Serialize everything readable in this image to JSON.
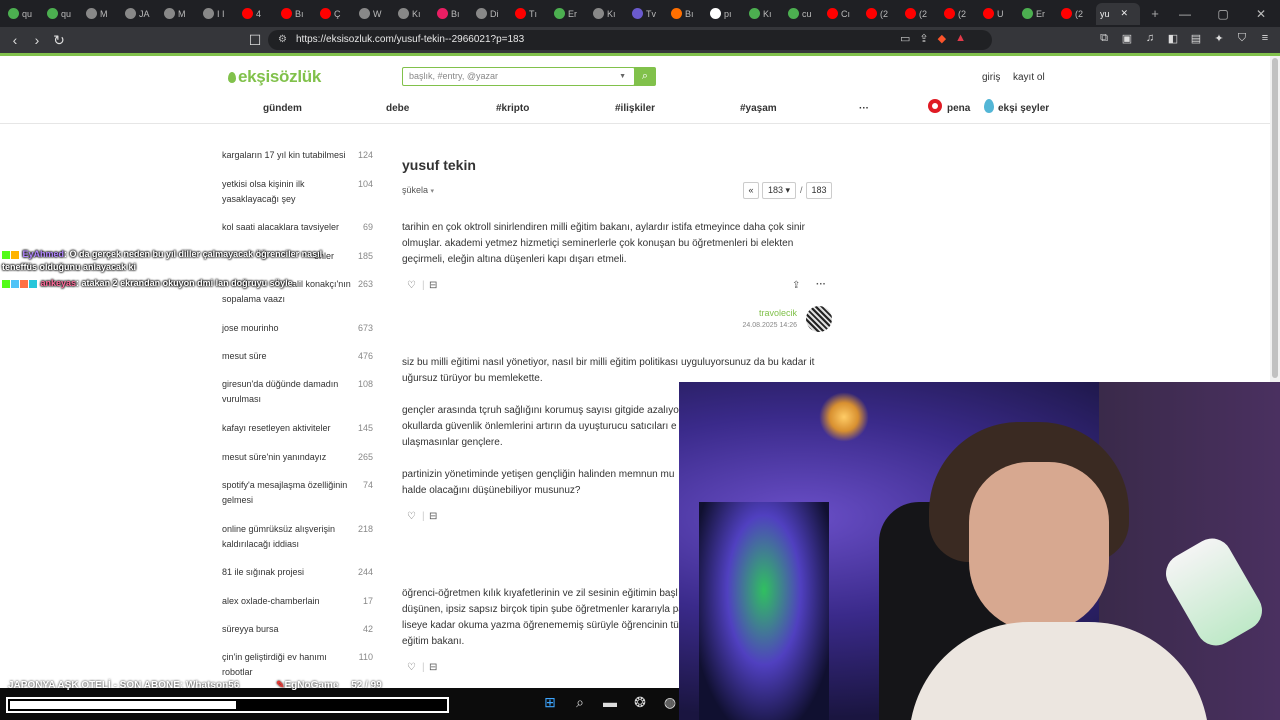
{
  "browser": {
    "tabs": [
      {
        "label": "qu",
        "color": "#4caf50"
      },
      {
        "label": "qu",
        "color": "#4caf50"
      },
      {
        "label": "M",
        "color": "#888"
      },
      {
        "label": "JA",
        "color": "#888"
      },
      {
        "label": "M",
        "color": "#888"
      },
      {
        "label": "I I",
        "color": "#888"
      },
      {
        "label": "4",
        "color": "#ff0000"
      },
      {
        "label": "Bı",
        "color": "#ff0000"
      },
      {
        "label": "Ç",
        "color": "#ff0000"
      },
      {
        "label": "W",
        "color": "#888"
      },
      {
        "label": "Kı",
        "color": "#888"
      },
      {
        "label": "Bı",
        "color": "#e91e63"
      },
      {
        "label": "Di",
        "color": "#888"
      },
      {
        "label": "Tı",
        "color": "#ff0000"
      },
      {
        "label": "Er",
        "color": "#4caf50"
      },
      {
        "label": "Kı",
        "color": "#888"
      },
      {
        "label": "Tv",
        "color": "#6a5acd"
      },
      {
        "label": "Bı",
        "color": "#ff6f00"
      },
      {
        "label": "pı",
        "color": "#fff"
      },
      {
        "label": "Kı",
        "color": "#4caf50"
      },
      {
        "label": "cu",
        "color": "#4caf50"
      },
      {
        "label": "Cı",
        "color": "#ff0000"
      },
      {
        "label": "(2",
        "color": "#ff0000"
      },
      {
        "label": "(2",
        "color": "#ff0000"
      },
      {
        "label": "(2",
        "color": "#ff0000"
      },
      {
        "label": "U",
        "color": "#ff0000"
      },
      {
        "label": "Er",
        "color": "#4caf50"
      },
      {
        "label": "(2",
        "color": "#ff0000"
      }
    ],
    "active_tab": {
      "label": "yu"
    },
    "url": "https://eksisozluk.com/yusuf-tekin--2966021?p=183"
  },
  "site": {
    "logo": "ekşisözlük",
    "search_placeholder": "başlık, #entry, @yazar",
    "login": "giriş",
    "register": "kayıt ol",
    "nav": [
      "gündem",
      "debe",
      "#kripto",
      "#ilişkiler",
      "#yaşam",
      "···"
    ],
    "pena": "pena",
    "seyler": "ekşi şeyler"
  },
  "sidebar": [
    {
      "title": "kargaların 17 yıl kin tutabilmesi",
      "count": "124"
    },
    {
      "title": "yetkisi olsa kişinin ilk yasaklayacağı şey",
      "count": "104"
    },
    {
      "title": "kol saati alacaklara tavsiyeler",
      "count": "69"
    },
    {
      "title": "enler",
      "count": "185"
    },
    {
      "title": "alil konakçı'nın sopalama vaazı",
      "count": "263"
    },
    {
      "title": "jose mourinho",
      "count": "673"
    },
    {
      "title": "mesut süre",
      "count": "476"
    },
    {
      "title": "giresun'da düğünde damadın vurulması",
      "count": "108"
    },
    {
      "title": "kafayı resetleyen aktiviteler",
      "count": "145"
    },
    {
      "title": "mesut süre'nin yanındayız",
      "count": "265"
    },
    {
      "title": "spotify'a mesajlaşma özelliğinin gelmesi",
      "count": "74"
    },
    {
      "title": "online gümrüksüz alışverişin kaldırılacağı iddiası",
      "count": "218"
    },
    {
      "title": "81 ile sığınak projesi",
      "count": "244"
    },
    {
      "title": "alex oxlade-chamberlain",
      "count": "17"
    },
    {
      "title": "süreyya bursa",
      "count": "42"
    },
    {
      "title": "çin'in geliştirdiği ev hanımı robotlar",
      "count": "110"
    }
  ],
  "main": {
    "title": "yusuf tekin",
    "sukela": "şükela",
    "pager": {
      "prev": "«",
      "current": "183",
      "total": "183"
    },
    "entry1": "tarihin en çok oktroll sinirlendiren milli eğitim bakanı, aylardır istifa etmeyince daha çok sinir olmuşlar. akademi yetmez hizmetiçi seminerlerle çok konuşan bu öğretmenleri bi elekten geçirmeli, eleğin altına düşenleri kapı dışarı etmeli.",
    "author": "travolecik",
    "date": "24.08.2025 14:26",
    "entry2_p1": "siz bu milli eğitimi nasıl yönetiyor, nasıl bir milli eğitim politikası uyguluyorsunuz da bu kadar it uğursuz türüyor bu memlekette.",
    "entry2_p2": "gençler arasında tçruh sağlığını korumuş sayısı gitgide azalıyor,",
    "entry2_p2b": "okullarda güvenlik önlemlerini artırın da uyuşturucu satıcıları e",
    "entry2_p2c": "ulaşmasınlar gençlere.",
    "entry2_p3": "partinizin yönetiminde yetişen gençliğin halinden memnun mu",
    "entry2_p3b": "halde olacağını düşünebiliyor musunuz?",
    "entry3_l1": "öğrenci-öğretmen kılık kıyafetlerinin ve zil sesinin eğitimin başl",
    "entry3_l2": "düşünen, ipsiz sapsız birçok tipin şube öğretmenler kararıyla pa",
    "entry3_l3": "liseye kadar okuma yazma öğrenememiş sürüyle öğrencinin tü",
    "entry3_l4": "eğitim bakanı."
  },
  "overlay": {
    "chat1_user": "EyAhmed",
    "chat1_text": ": O da gerçek neden bu yıl diller çalmayacak öğrenciler nasıl",
    "chat1_text2": "teneffüs olduğunu anlayacak ki",
    "chat2_user": "ankeyas",
    "chat2_text": ": atakan 2 ekrandan okuyon dmi lan doğruyu söyle",
    "marquee": "JAPONYA AŞK OTELİ - SON ABONE: Whatson56",
    "marquee2": "EgNoGame",
    "marquee3": "52 / 99",
    "progress": 0.52
  }
}
